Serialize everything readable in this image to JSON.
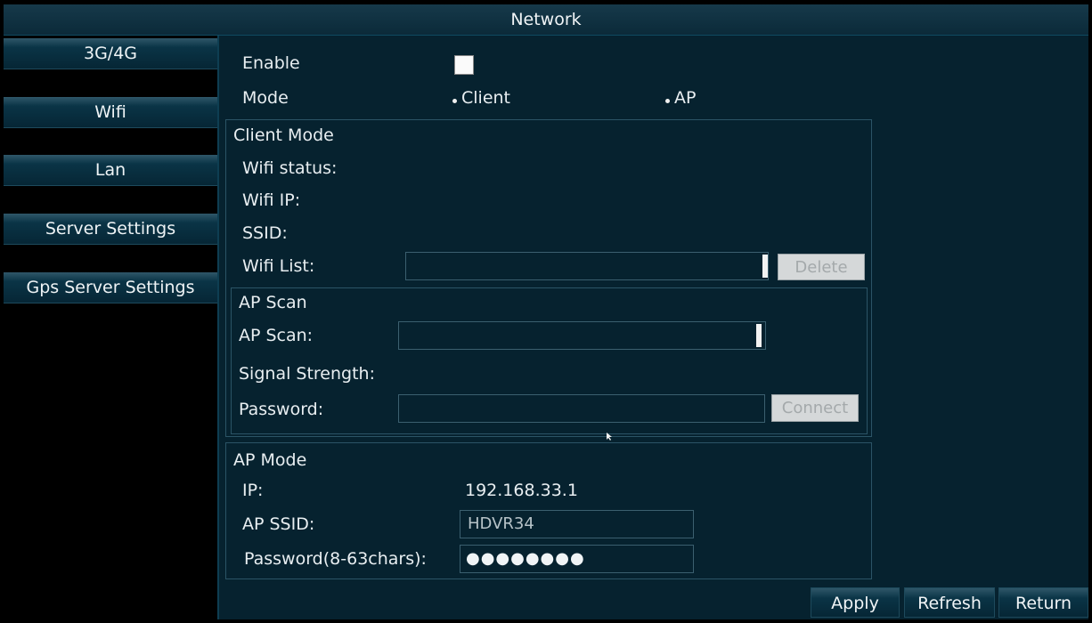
{
  "window": {
    "title": "Network"
  },
  "sidebar": {
    "items": [
      {
        "label": "3G/4G"
      },
      {
        "label": "Wifi"
      },
      {
        "label": "Lan"
      },
      {
        "label": "Server Settings"
      },
      {
        "label": "Gps Server Settings"
      }
    ]
  },
  "wifi": {
    "enable_label": "Enable",
    "enable_checked": false,
    "mode_label": "Mode",
    "mode_options": [
      "Client",
      "AP"
    ],
    "client_mode": {
      "title": "Client Mode",
      "status_label": "Wifi status:",
      "ip_label": "Wifi IP:",
      "ssid_label": "SSID:",
      "list_label": "Wifi List:",
      "delete_button": "Delete"
    },
    "ap_scan": {
      "title": "AP Scan",
      "scan_label": "AP Scan:",
      "signal_label": "Signal Strength:",
      "password_label": "Password:",
      "connect_button": "Connect"
    },
    "ap_mode": {
      "title": "AP Mode",
      "ip_label": "IP:",
      "ip_value": "192.168.33.1",
      "ssid_label": "AP SSID:",
      "ssid_value": "HDVR34",
      "password_label": "Password(8-63chars):",
      "password_value": "●●●●●●●●"
    }
  },
  "footer": {
    "apply": "Apply",
    "refresh": "Refresh",
    "return": "Return"
  }
}
